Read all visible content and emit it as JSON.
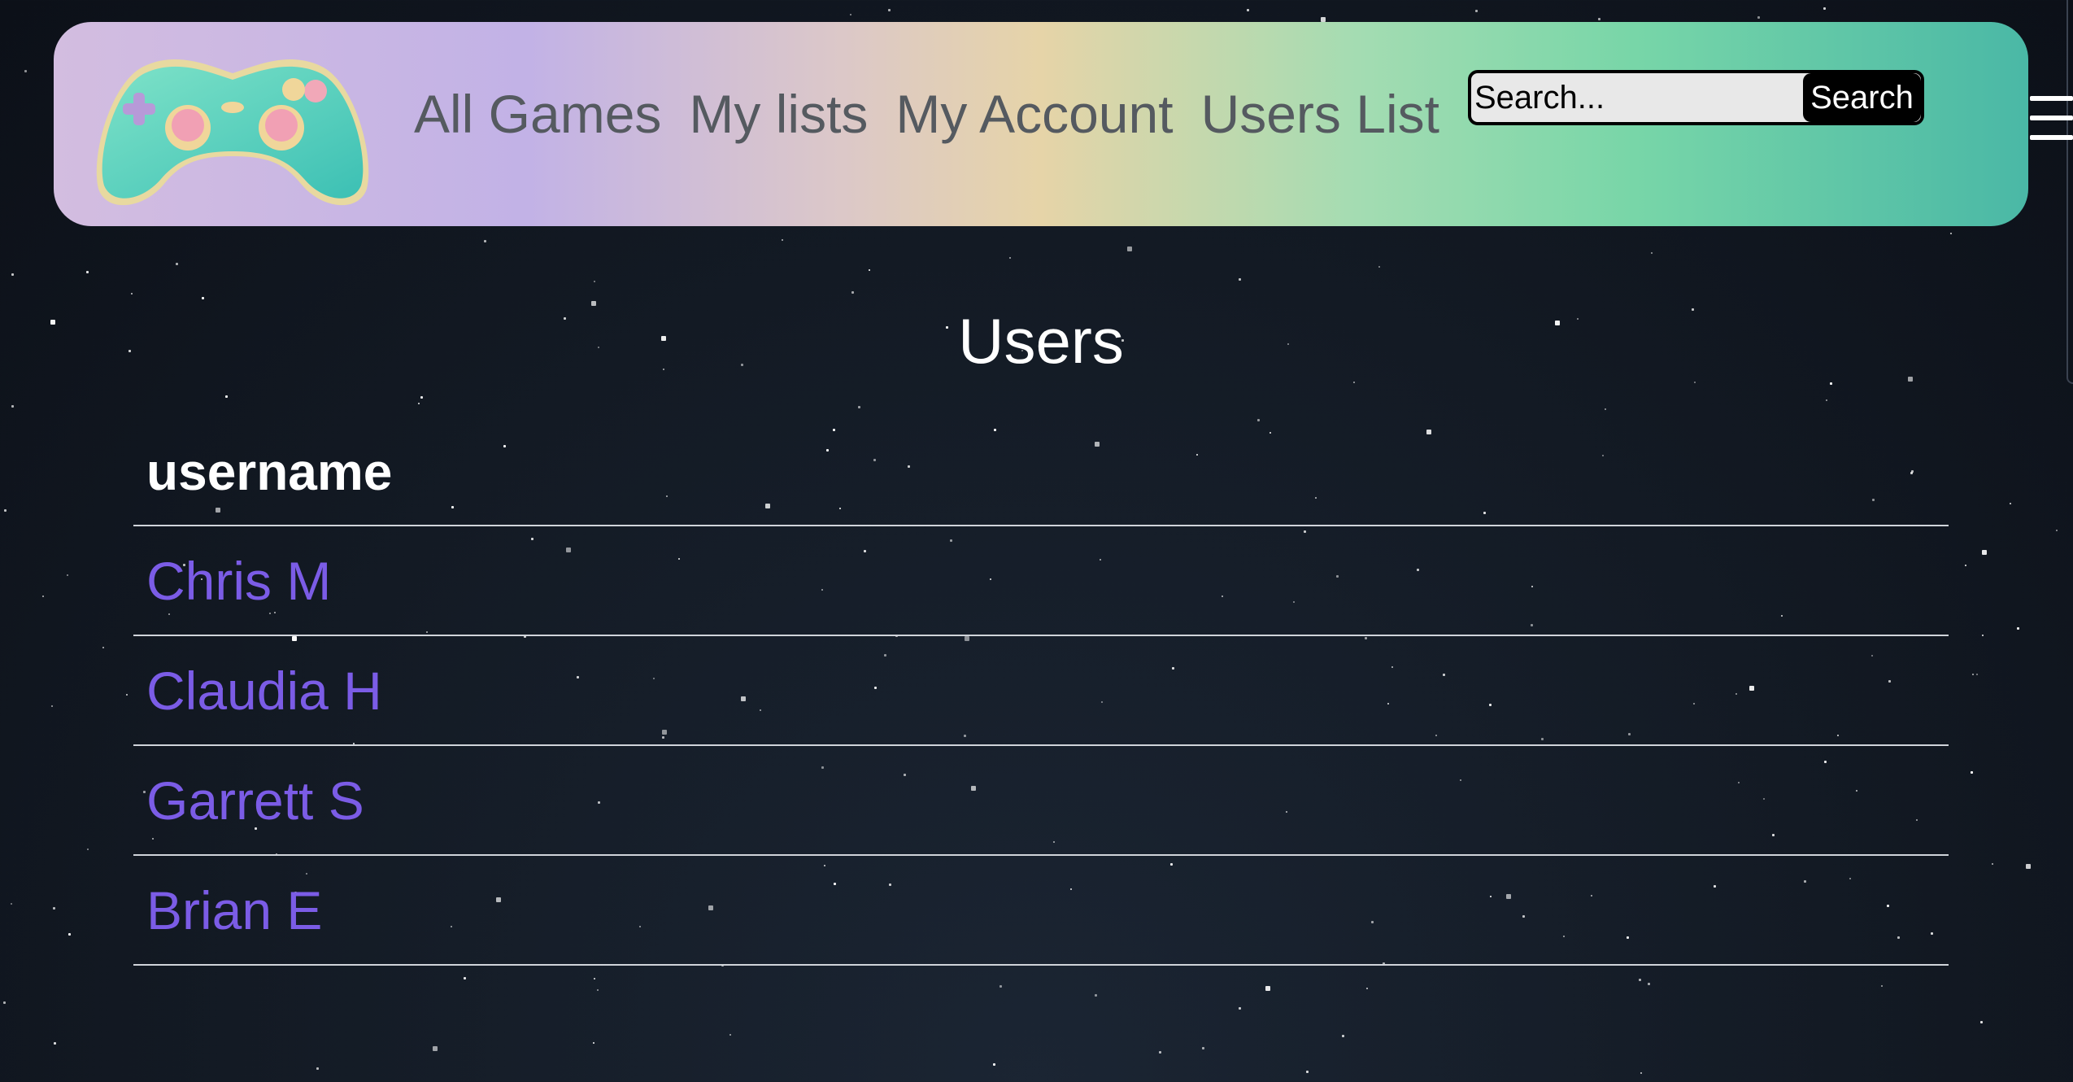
{
  "nav": {
    "links": [
      {
        "label": "All Games"
      },
      {
        "label": "My lists"
      },
      {
        "label": "My Account"
      },
      {
        "label": "Users List"
      }
    ],
    "search_placeholder": "Search...",
    "search_button_label": "Search",
    "logo_icon": "game-controller-icon",
    "menu_icon": "hamburger-menu-icon"
  },
  "page": {
    "title": "Users"
  },
  "users_table": {
    "columns": [
      "username"
    ],
    "rows": [
      {
        "username": "Chris M"
      },
      {
        "username": "Claudia H"
      },
      {
        "username": "Garrett S"
      },
      {
        "username": "Brian E"
      }
    ]
  },
  "colors": {
    "background": "#131a24",
    "link": "#7b5ce6",
    "nav_text": "#555a60",
    "nav_gradient_start": "#d3bde0",
    "nav_gradient_end": "#4ab8a6"
  }
}
